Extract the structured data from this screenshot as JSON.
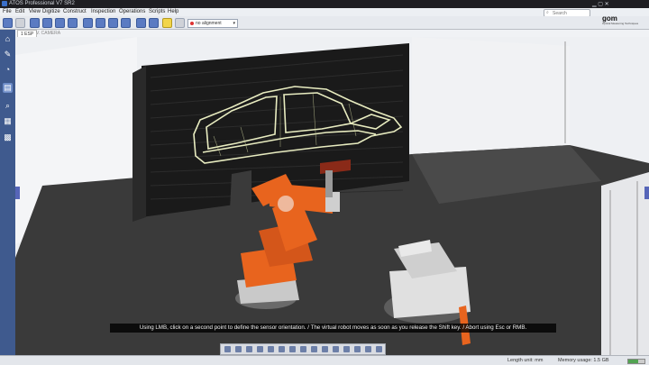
{
  "window": {
    "title": "ATOS Professional V7 SR2"
  },
  "menu": [
    "File",
    "Edit",
    "View",
    "Digitize",
    "Construct",
    "Inspection",
    "Operations",
    "Scripts",
    "Help"
  ],
  "search": {
    "placeholder": "Search"
  },
  "brand": {
    "logo_text": "gom",
    "tagline": "Optical Measuring Techniques"
  },
  "toolbar": {
    "alignment_label": "no alignment"
  },
  "tabs": [
    "1 ESP",
    "V. CAMERA"
  ],
  "caption": "Using LMB, click on a second point to define the sensor orientation. / The virtual robot moves as soon as you release the Shift key. / Abort using Esc or RMB.",
  "status": {
    "length_unit_label": "Length unit: mm",
    "memory_label": "Memory usage: 1.5 GB",
    "memory_fraction": 0.6
  },
  "colors": {
    "robot": "#e8641e",
    "accent": "#3f5a8e",
    "wall": "#1a1a1a",
    "floor": "#3a3a3a"
  }
}
